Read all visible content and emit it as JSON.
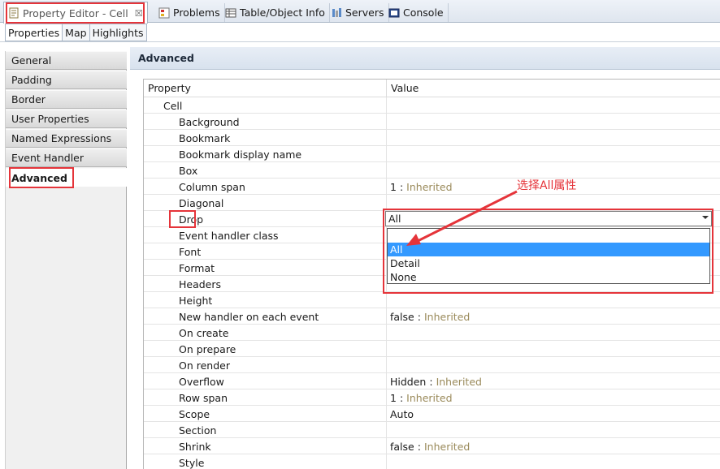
{
  "view_tabs": [
    {
      "label": "Property Editor - Cell",
      "icon": "property-editor-icon",
      "active": true
    },
    {
      "label": "Problems",
      "icon": "problems-icon"
    },
    {
      "label": "Table/Object Info",
      "icon": "table-icon"
    },
    {
      "label": "Servers",
      "icon": "servers-icon"
    },
    {
      "label": "Console",
      "icon": "console-icon"
    }
  ],
  "close_glyph": "☒",
  "sub_tabs": [
    "Properties",
    "Map",
    "Highlights"
  ],
  "categories": [
    "General",
    "Padding",
    "Border",
    "User Properties",
    "Named Expressions",
    "Event Handler",
    "Advanced"
  ],
  "selected_category": "Advanced",
  "section_title": "Advanced",
  "table": {
    "headers": {
      "property": "Property",
      "value": "Value"
    },
    "group": "Cell",
    "rows": [
      {
        "name": "Background",
        "value": "",
        "inherited": ""
      },
      {
        "name": "Bookmark",
        "value": "",
        "inherited": ""
      },
      {
        "name": "Bookmark display name",
        "value": "",
        "inherited": ""
      },
      {
        "name": "Box",
        "value": "",
        "inherited": ""
      },
      {
        "name": "Column span",
        "value": "1",
        "inherited": "Inherited"
      },
      {
        "name": "Diagonal",
        "value": "",
        "inherited": ""
      },
      {
        "name": "Drop",
        "value": "All",
        "inherited": ""
      },
      {
        "name": "Event handler class",
        "value": "",
        "inherited": ""
      },
      {
        "name": "Font",
        "value": "",
        "inherited": ""
      },
      {
        "name": "Format",
        "value": "",
        "inherited": ""
      },
      {
        "name": "Headers",
        "value": "",
        "inherited": ""
      },
      {
        "name": "Height",
        "value": "",
        "inherited": ""
      },
      {
        "name": "New handler on each event",
        "value": "false",
        "inherited": "Inherited"
      },
      {
        "name": "On create",
        "value": "",
        "inherited": ""
      },
      {
        "name": "On prepare",
        "value": "",
        "inherited": ""
      },
      {
        "name": "On render",
        "value": "",
        "inherited": ""
      },
      {
        "name": "Overflow",
        "value": "Hidden",
        "inherited": "Inherited"
      },
      {
        "name": "Row span",
        "value": "1",
        "inherited": "Inherited"
      },
      {
        "name": "Scope",
        "value": "Auto",
        "inherited": ""
      },
      {
        "name": "Section",
        "value": "",
        "inherited": ""
      },
      {
        "name": "Shrink",
        "value": "false",
        "inherited": "Inherited"
      },
      {
        "name": "Style",
        "value": "",
        "inherited": ""
      }
    ]
  },
  "drop_combo": {
    "value": "All",
    "options": [
      "All",
      "Detail",
      "None"
    ],
    "selected": "All"
  },
  "annotation": {
    "text": "选择All属性",
    "color": "#e5343a"
  },
  "colors": {
    "selection": "#3399ff",
    "inherited_text": "#9a8a5a",
    "annotation_red": "#e5343a"
  }
}
